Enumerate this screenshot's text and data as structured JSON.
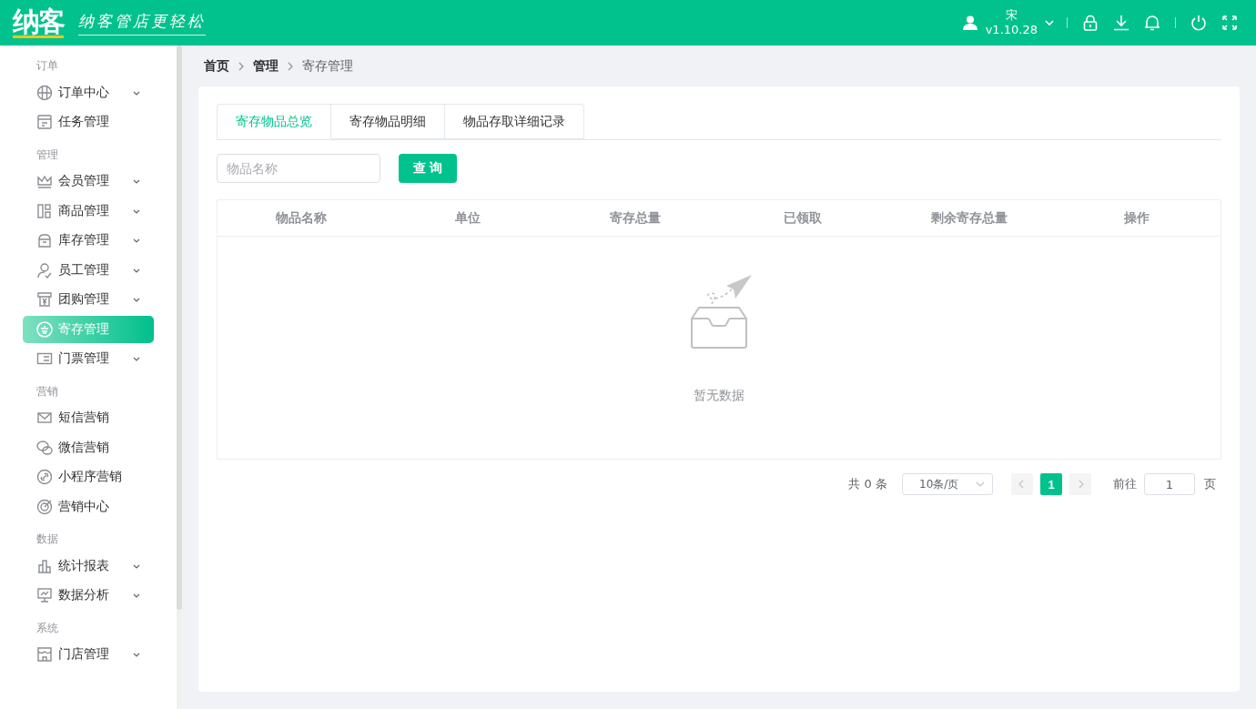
{
  "header": {
    "logo": "纳客",
    "slogan": "纳客管店更轻松",
    "user": {
      "name": "宋",
      "version": "v1.10.28"
    }
  },
  "sidebar": {
    "groups": [
      {
        "title": "订单",
        "items": [
          {
            "label": "订单中心",
            "expandable": true,
            "selected": false
          },
          {
            "label": "任务管理",
            "expandable": false,
            "selected": false
          }
        ]
      },
      {
        "title": "管理",
        "items": [
          {
            "label": "会员管理",
            "expandable": true,
            "selected": false
          },
          {
            "label": "商品管理",
            "expandable": true,
            "selected": false
          },
          {
            "label": "库存管理",
            "expandable": true,
            "selected": false
          },
          {
            "label": "员工管理",
            "expandable": true,
            "selected": false
          },
          {
            "label": "团购管理",
            "expandable": true,
            "selected": false
          },
          {
            "label": "寄存管理",
            "expandable": false,
            "selected": true
          },
          {
            "label": "门票管理",
            "expandable": true,
            "selected": false
          }
        ]
      },
      {
        "title": "营销",
        "items": [
          {
            "label": "短信营销",
            "expandable": false,
            "selected": false
          },
          {
            "label": "微信营销",
            "expandable": false,
            "selected": false
          },
          {
            "label": "小程序营销",
            "expandable": false,
            "selected": false
          },
          {
            "label": "营销中心",
            "expandable": false,
            "selected": false
          }
        ]
      },
      {
        "title": "数据",
        "items": [
          {
            "label": "统计报表",
            "expandable": true,
            "selected": false
          },
          {
            "label": "数据分析",
            "expandable": true,
            "selected": false
          }
        ]
      },
      {
        "title": "系统",
        "items": [
          {
            "label": "门店管理",
            "expandable": true,
            "selected": false
          }
        ]
      }
    ]
  },
  "breadcrumb": [
    {
      "label": "首页",
      "current": false
    },
    {
      "label": "管理",
      "current": false
    },
    {
      "label": "寄存管理",
      "current": true
    }
  ],
  "tabs": [
    {
      "label": "寄存物品总览",
      "selected": true
    },
    {
      "label": "寄存物品明细",
      "selected": false
    },
    {
      "label": "物品存取详细记录",
      "selected": false
    }
  ],
  "search": {
    "placeholder": "物品名称",
    "button": "查 询"
  },
  "table": {
    "columns": [
      "物品名称",
      "单位",
      "寄存总量",
      "已领取",
      "剩余寄存总量",
      "操作"
    ],
    "empty_text": "暂无数据"
  },
  "pagination": {
    "total": "共 0 条",
    "page_size": "10条/页",
    "pages": [
      {
        "label": "1",
        "selected": true
      }
    ],
    "goto_label": "前往",
    "goto_value": "1",
    "goto_suffix": "页"
  }
}
